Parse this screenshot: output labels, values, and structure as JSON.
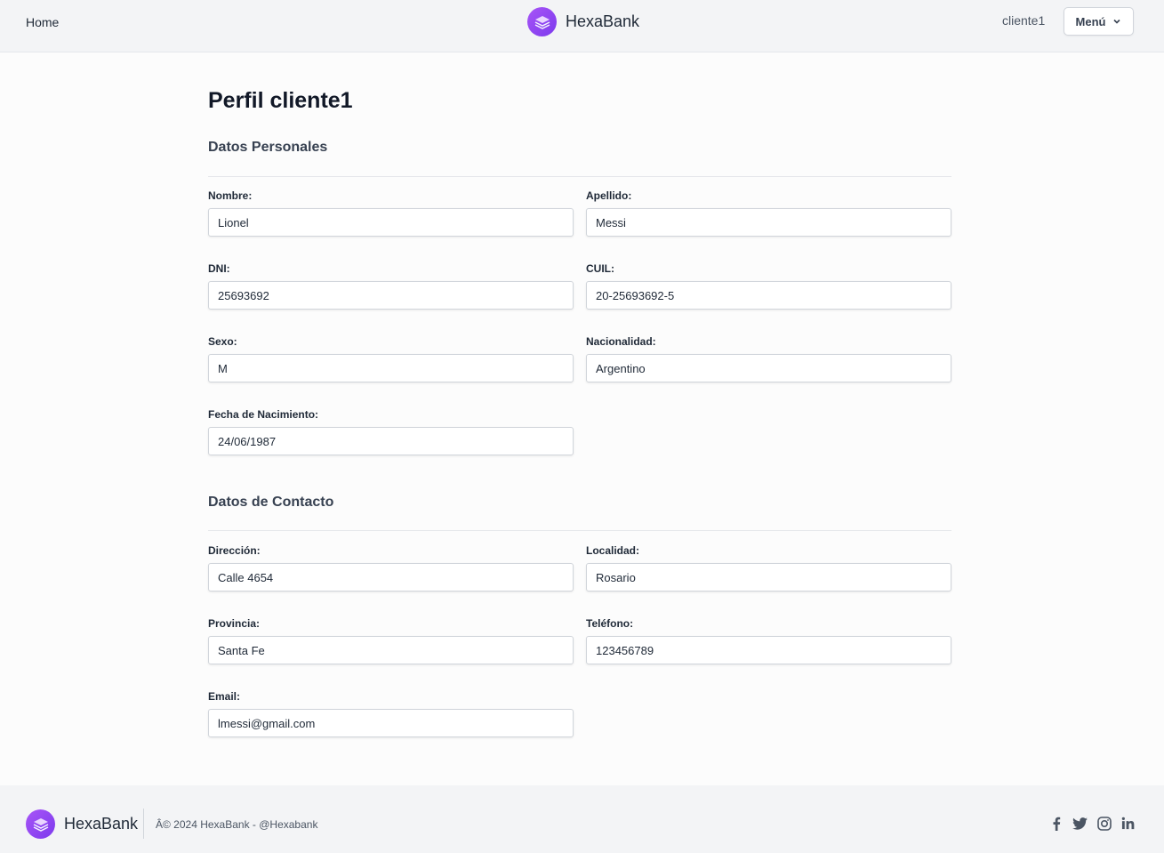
{
  "header": {
    "home": "Home",
    "brand": "HexaBank",
    "username": "cliente1",
    "menu_label": "Menú"
  },
  "page": {
    "title": "Perfil cliente1"
  },
  "personal": {
    "section_title": "Datos Personales",
    "nombre_label": "Nombre:",
    "nombre": "Lionel",
    "apellido_label": "Apellido:",
    "apellido": "Messi",
    "dni_label": "DNI:",
    "dni": "25693692",
    "cuil_label": "CUIL:",
    "cuil": "20-25693692-5",
    "sexo_label": "Sexo:",
    "sexo": "M",
    "nacionalidad_label": "Nacionalidad:",
    "nacionalidad": "Argentino",
    "fecha_label": "Fecha de Nacimiento:",
    "fecha": "24/06/1987"
  },
  "contact": {
    "section_title": "Datos de Contacto",
    "direccion_label": "Dirección:",
    "direccion": "Calle 4654",
    "localidad_label": "Localidad:",
    "localidad": "Rosario",
    "provincia_label": "Provincia:",
    "provincia": "Santa Fe",
    "telefono_label": "Teléfono:",
    "telefono": "123456789",
    "email_label": "Email:",
    "email": "lmessi@gmail.com"
  },
  "footer": {
    "brand": "HexaBank",
    "copyright": "Â© 2024 HexaBank  - @Hexabank",
    "icons": [
      "facebook-icon",
      "twitter-icon",
      "instagram-icon",
      "linkedin-icon"
    ]
  },
  "colors": {
    "brand_purple": "#8b5cf6",
    "header_bg": "#f3f4f6"
  }
}
